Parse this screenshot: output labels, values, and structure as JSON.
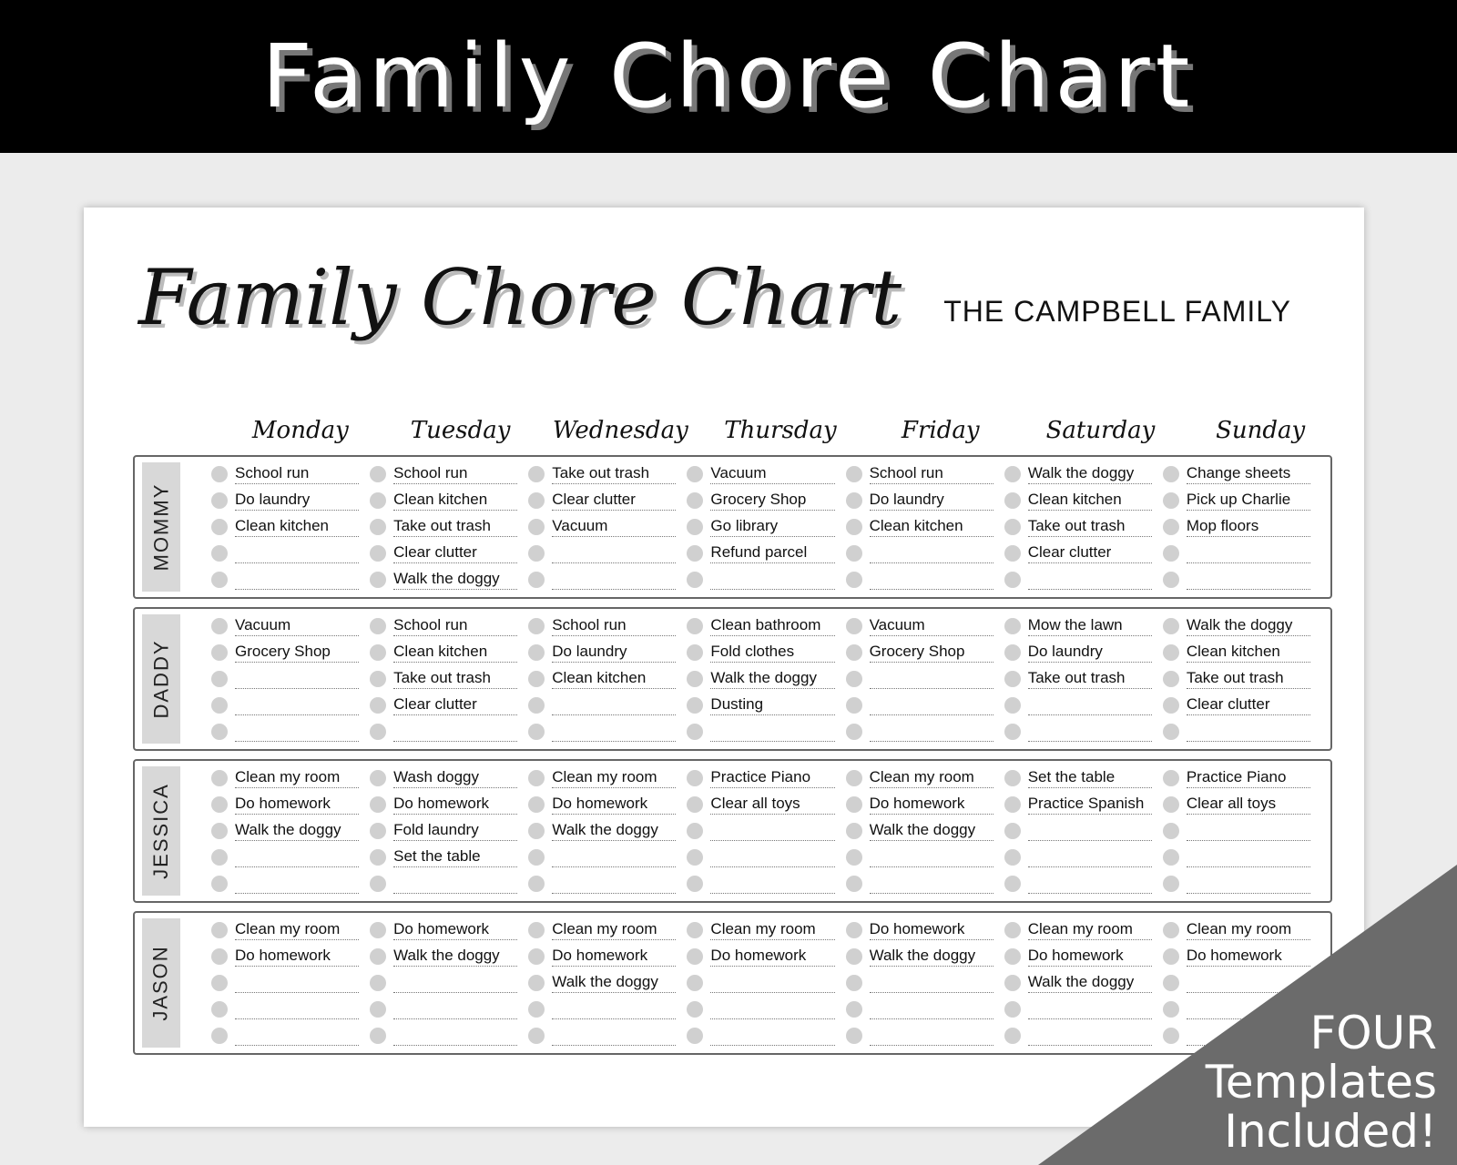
{
  "banner": {
    "title": "Family Chore Chart"
  },
  "sheet": {
    "title": "Family Chore Chart",
    "family_name": "THE CAMPBELL FAMILY",
    "days": [
      "Monday",
      "Tuesday",
      "Wednesday",
      "Thursday",
      "Friday",
      "Saturday",
      "Sunday"
    ],
    "members": [
      {
        "name": "MOMMY",
        "chores": [
          [
            "School run",
            "Do laundry",
            "Clean kitchen",
            "",
            ""
          ],
          [
            "School run",
            "Clean kitchen",
            "Take out trash",
            "Clear clutter",
            "Walk the doggy"
          ],
          [
            "Take out trash",
            "Clear clutter",
            "Vacuum",
            "",
            ""
          ],
          [
            "Vacuum",
            "Grocery Shop",
            "Go library",
            "Refund parcel",
            ""
          ],
          [
            "School run",
            "Do laundry",
            "Clean kitchen",
            "",
            ""
          ],
          [
            "Walk the doggy",
            "Clean kitchen",
            "Take out trash",
            "Clear clutter",
            ""
          ],
          [
            "Change sheets",
            "Pick up Charlie",
            "Mop floors",
            "",
            ""
          ]
        ]
      },
      {
        "name": "DADDY",
        "chores": [
          [
            "Vacuum",
            "Grocery Shop",
            "",
            "",
            ""
          ],
          [
            "School run",
            "Clean kitchen",
            "Take out trash",
            "Clear clutter",
            ""
          ],
          [
            "School run",
            "Do laundry",
            "Clean kitchen",
            "",
            ""
          ],
          [
            "Clean bathroom",
            "Fold clothes",
            "Walk the doggy",
            "Dusting",
            ""
          ],
          [
            "Vacuum",
            "Grocery Shop",
            "",
            "",
            ""
          ],
          [
            "Mow the lawn",
            "Do laundry",
            "Take out trash",
            "",
            ""
          ],
          [
            "Walk the doggy",
            "Clean kitchen",
            "Take out trash",
            "Clear clutter",
            ""
          ]
        ]
      },
      {
        "name": "JESSICA",
        "chores": [
          [
            "Clean my room",
            "Do homework",
            "Walk the doggy",
            "",
            ""
          ],
          [
            "Wash doggy",
            "Do homework",
            "Fold laundry",
            "Set the table",
            ""
          ],
          [
            "Clean my room",
            "Do homework",
            "Walk the doggy",
            "",
            ""
          ],
          [
            "Practice Piano",
            "Clear all toys",
            "",
            "",
            ""
          ],
          [
            "Clean my room",
            "Do homework",
            "Walk the doggy",
            "",
            ""
          ],
          [
            "Set the table",
            "Practice Spanish",
            "",
            "",
            ""
          ],
          [
            "Practice Piano",
            "Clear all toys",
            "",
            "",
            ""
          ]
        ]
      },
      {
        "name": "JASON",
        "chores": [
          [
            "Clean my room",
            "Do homework",
            "",
            "",
            ""
          ],
          [
            "Do homework",
            "Walk the doggy",
            "",
            "",
            ""
          ],
          [
            "Clean my room",
            "Do homework",
            "Walk the doggy",
            "",
            ""
          ],
          [
            "Clean my room",
            "Do homework",
            "",
            "",
            ""
          ],
          [
            "Do homework",
            "Walk the doggy",
            "",
            "",
            ""
          ],
          [
            "Clean my room",
            "Do homework",
            "Walk the doggy",
            "",
            ""
          ],
          [
            "Clean my room",
            "Do homework",
            "",
            "",
            ""
          ]
        ]
      }
    ]
  },
  "corner_badge": {
    "line1": "FOUR",
    "line2": "Templates",
    "line3": "Included!"
  }
}
